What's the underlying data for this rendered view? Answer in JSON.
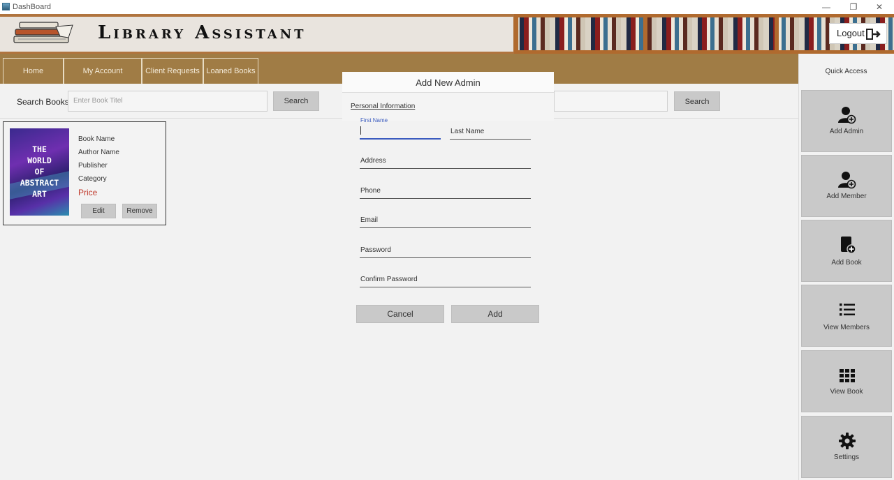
{
  "window": {
    "title": "DashBoard"
  },
  "banner": {
    "app_title": "Library Assistant",
    "logout_label": "Logout"
  },
  "nav": {
    "tabs": [
      "Home",
      "My Account",
      "Client Requests",
      "Loaned Books"
    ]
  },
  "search": {
    "label": "Search Books",
    "placeholder": "Enter Book Titel",
    "button": "Search",
    "button2": "Search"
  },
  "book": {
    "cover_text": [
      "THE",
      "WORLD",
      "OF",
      "ABSTRACT",
      "ART"
    ],
    "name": "Book Name",
    "author": "Author Name",
    "publisher": "Publisher",
    "category": "Category",
    "price": "Price",
    "edit": "Edit",
    "remove": "Remove"
  },
  "dialog": {
    "title": "Add New Admin",
    "section": "Personal Information",
    "first_name": "First Name",
    "last_name": "Last Name",
    "address": "Address",
    "phone": "Phone",
    "email": "Email",
    "password": "Password",
    "confirm_password": "Confirm Password",
    "cancel": "Cancel",
    "add": "Add"
  },
  "sidebar": {
    "title": "Quick Access",
    "items": [
      {
        "label": "Add Admin",
        "icon": "add-admin-icon"
      },
      {
        "label": "Add Member",
        "icon": "add-member-icon"
      },
      {
        "label": "Add Book",
        "icon": "add-book-icon"
      },
      {
        "label": "View Members",
        "icon": "list-icon"
      },
      {
        "label": "View Book",
        "icon": "grid-icon"
      },
      {
        "label": "Settings",
        "icon": "gear-icon"
      }
    ]
  },
  "colors": {
    "nav": "#a07c45",
    "price": "#c0392b",
    "tile": "#c9c9c9",
    "focus": "#3b5bbf"
  }
}
